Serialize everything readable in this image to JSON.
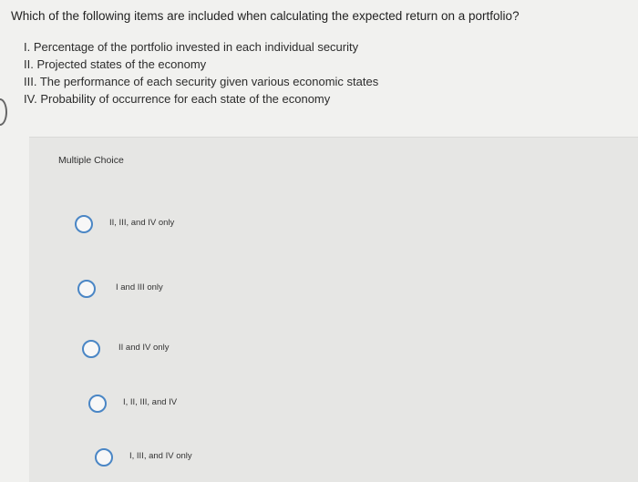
{
  "question": {
    "text": "Which of the following items are included when calculating the expected return on a portfolio?",
    "items": [
      "I. Percentage of the portfolio invested in each individual security",
      "II. Projected states of the economy",
      "III. The performance of each security given various economic states",
      "IV. Probability of occurrence for each state of the economy"
    ]
  },
  "multiple_choice": {
    "label": "Multiple Choice",
    "options": [
      "II, III, and IV only",
      "I and III only",
      "II and IV only",
      "I, II, III, and IV",
      "I, III, and IV only"
    ]
  },
  "colors": {
    "radio_border": "#4a86c5",
    "panel_background": "#e6e6e4",
    "page_background": "#f1f1ef"
  }
}
